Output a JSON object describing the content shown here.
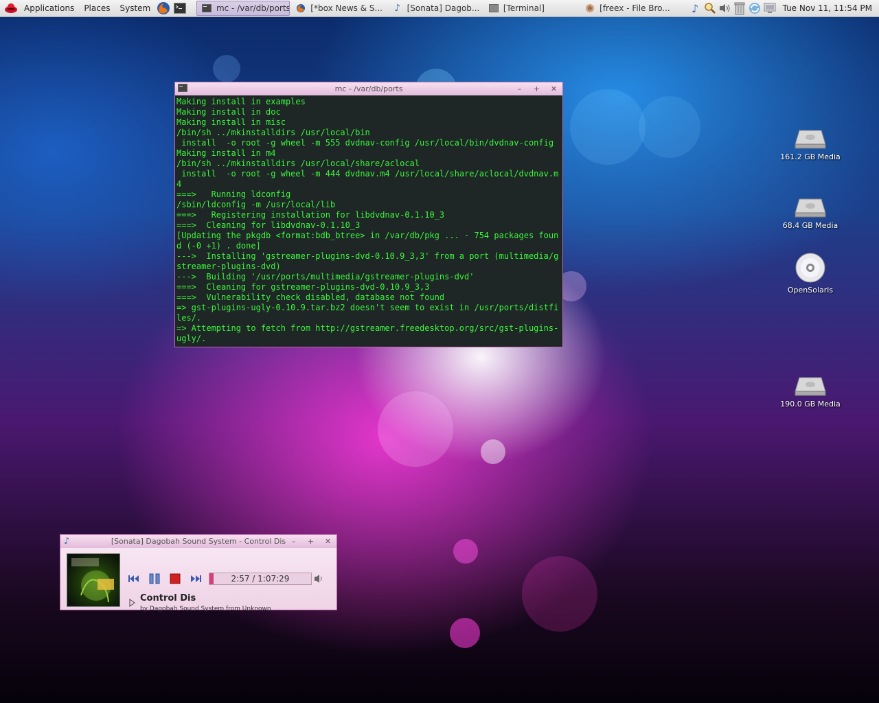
{
  "panel": {
    "menus": [
      "Applications",
      "Places",
      "System"
    ],
    "tasks": [
      {
        "label": "mc - /var/db/ports",
        "active": true
      },
      {
        "label": "[*box News & S...",
        "active": false
      },
      {
        "label": "[Sonata] Dagob...",
        "active": false
      },
      {
        "label": "[Terminal]",
        "active": false
      },
      {
        "label": "[freex - File Bro...",
        "active": false
      }
    ],
    "clock": "Tue Nov 11, 11:54 PM"
  },
  "terminal": {
    "title": "mc - /var/db/ports",
    "lines": [
      "Making install in examples",
      "Making install in doc",
      "Making install in misc",
      "/bin/sh ../mkinstalldirs /usr/local/bin",
      " install  -o root -g wheel -m 555 dvdnav-config /usr/local/bin/dvdnav-config",
      "Making install in m4",
      "/bin/sh ../mkinstalldirs /usr/local/share/aclocal",
      " install  -o root -g wheel -m 444 dvdnav.m4 /usr/local/share/aclocal/dvdnav.m4",
      "===>   Running ldconfig",
      "/sbin/ldconfig -m /usr/local/lib",
      "===>   Registering installation for libdvdnav-0.1.10_3",
      "===>  Cleaning for libdvdnav-0.1.10_3",
      "[Updating the pkgdb <format:bdb_btree> in /var/db/pkg ... - 754 packages found (-0 +1) . done]",
      "--->  Installing 'gstreamer-plugins-dvd-0.10.9_3,3' from a port (multimedia/gstreamer-plugins-dvd)",
      "--->  Building '/usr/ports/multimedia/gstreamer-plugins-dvd'",
      "===>  Cleaning for gstreamer-plugins-dvd-0.10.9_3,3",
      "===>  Vulnerability check disabled, database not found",
      "=> gst-plugins-ugly-0.10.9.tar.bz2 doesn't seem to exist in /usr/ports/distfiles/.",
      "=> Attempting to fetch from http://gstreamer.freedesktop.org/src/gst-plugins-ugly/."
    ]
  },
  "sonata": {
    "title": "[Sonata] Dagobah Sound System - Control Dis",
    "time": "2:57 / 1:07:29",
    "progress": 0.04,
    "song": "Control Dis",
    "subtitle": "by Dagobah Sound System from Unknown"
  },
  "desktop": {
    "icons": [
      {
        "label": "161.2 GB Media",
        "type": "drive"
      },
      {
        "label": "68.4 GB Media",
        "type": "drive"
      },
      {
        "label": "OpenSolaris",
        "type": "cdrom"
      },
      {
        "label": "190.0 GB Media",
        "type": "drive"
      }
    ]
  },
  "colors": {
    "terminal_text": "#3cf53c",
    "terminal_bg": "#1e2424",
    "title_gradient_top": "#f6e0f0",
    "title_gradient_bottom": "#e4bcdc",
    "progress_fill": "#d0407a"
  }
}
